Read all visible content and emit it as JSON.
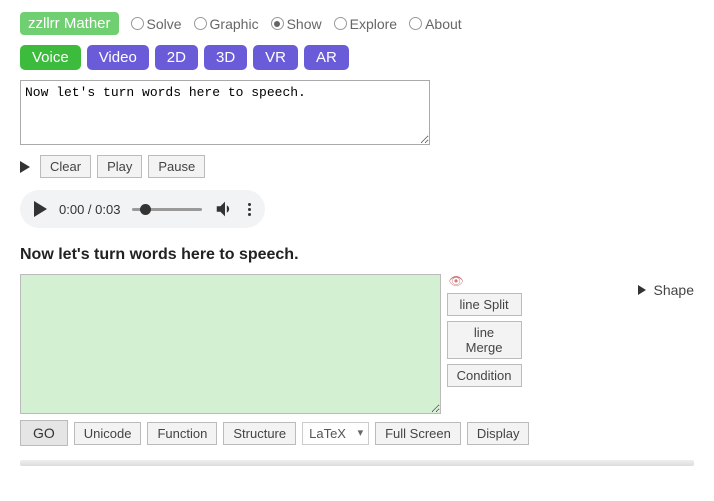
{
  "logo": "zzllrr Mather",
  "nav": {
    "solve": "Solve",
    "graphic": "Graphic",
    "show": "Show",
    "explore": "Explore",
    "about": "About",
    "selected": "show"
  },
  "tabs": {
    "voice": "Voice",
    "video": "Video",
    "d2": "2D",
    "d3": "3D",
    "vr": "VR",
    "ar": "AR"
  },
  "input_text": "Now let's turn words here to speech.",
  "controls": {
    "clear": "Clear",
    "play": "Play",
    "pause": "Pause"
  },
  "audio": {
    "time": "0:00 / 0:03"
  },
  "speech_output": "Now let's turn words here to speech.",
  "side": {
    "line_split": "line Split",
    "line_merge": "line Merge",
    "condition": "Condition",
    "shape": "Shape"
  },
  "bottom": {
    "go": "GO",
    "unicode": "Unicode",
    "function": "Function",
    "structure": "Structure",
    "latex_selected": "LaTeX",
    "full_screen": "Full Screen",
    "display": "Display"
  }
}
